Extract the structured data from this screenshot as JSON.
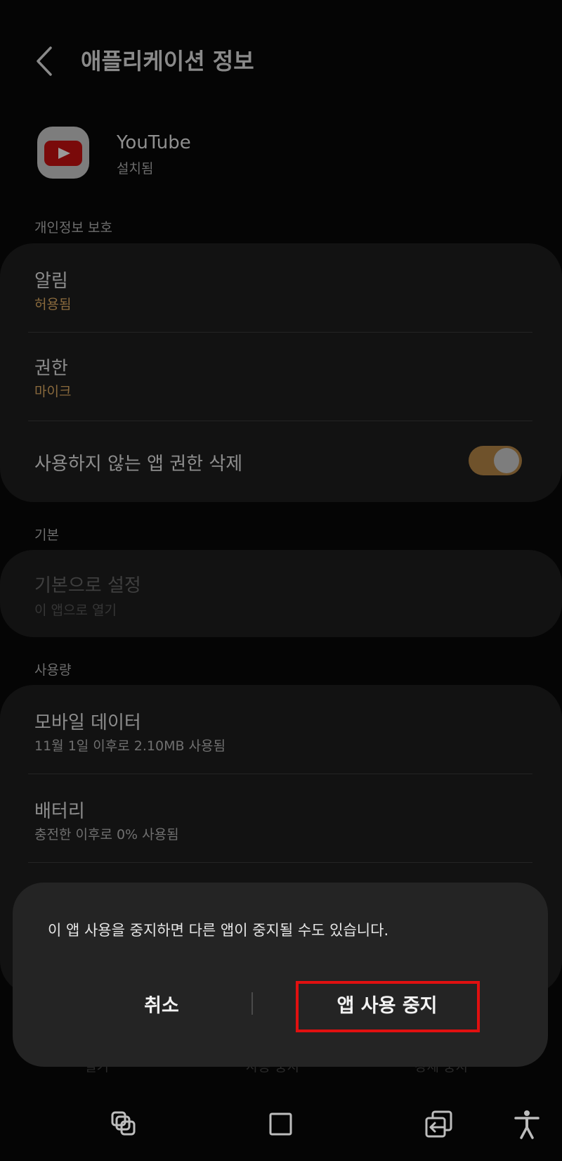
{
  "header": {
    "title": "애플리케이션 정보"
  },
  "app": {
    "name": "YouTube",
    "status": "설치됨"
  },
  "sections": {
    "privacy": "개인정보 보호",
    "default": "기본",
    "usage": "사용량"
  },
  "privacy": {
    "notifications": {
      "title": "알림",
      "value": "허용됨"
    },
    "permissions": {
      "title": "권한",
      "value": "마이크"
    },
    "remove_unused": {
      "title": "사용하지 않는 앱 권한 삭제",
      "enabled": true
    }
  },
  "defaults": {
    "title": "기본으로 설정",
    "value": "이 앱으로 열기"
  },
  "usage": {
    "mobile_data": {
      "title": "모바일 데이터",
      "value": "11월 1일 이후로 2.10MB 사용됨"
    },
    "battery": {
      "title": "배터리",
      "value": "충전한 이후로 0% 사용됨"
    }
  },
  "bottom_actions": {
    "open": "열기",
    "disable": "사용 중지",
    "force_stop": "강제 중지"
  },
  "dialog": {
    "message": "이 앱 사용을 중지하면 다른 앱이 중지될 수도 있습니다.",
    "cancel_label": "취소",
    "confirm_label": "앱 사용 중지"
  },
  "colors": {
    "accent": "#8a6a3d",
    "highlight": "#e01010",
    "dialog_bg": "#242424"
  },
  "icons": {
    "back": "chevron-left-icon",
    "recents": "recent-apps-icon",
    "home": "home-icon",
    "nav_back": "back-icon",
    "accessibility": "accessibility-icon"
  }
}
